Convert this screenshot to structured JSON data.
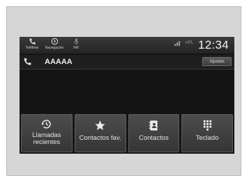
{
  "status_bar": {
    "items": [
      {
        "label": "Teléfono",
        "icon": "phone-icon"
      },
      {
        "label": "Navegación",
        "icon": "navigation-icon"
      },
      {
        "label": "FM",
        "icon": "radio-icon"
      }
    ],
    "signal_text": "HFL",
    "clock": "12:34"
  },
  "call_bar": {
    "icon": "phone-handset-icon",
    "caller_name": "AAAAA",
    "settings_label": "Ajustes"
  },
  "menu": {
    "buttons": [
      {
        "label": "Llamadas\nrecientes",
        "icon": "recent-calls-icon"
      },
      {
        "label": "Contactos fav.",
        "icon": "star-icon"
      },
      {
        "label": "Contactos",
        "icon": "contacts-icon"
      },
      {
        "label": "Teclado",
        "icon": "keypad-icon"
      }
    ]
  },
  "colors": {
    "frame_bg": "#d6d6d6",
    "screen_bg": "#141414",
    "button_bg": "#454545",
    "text": "#e6e6e6"
  }
}
